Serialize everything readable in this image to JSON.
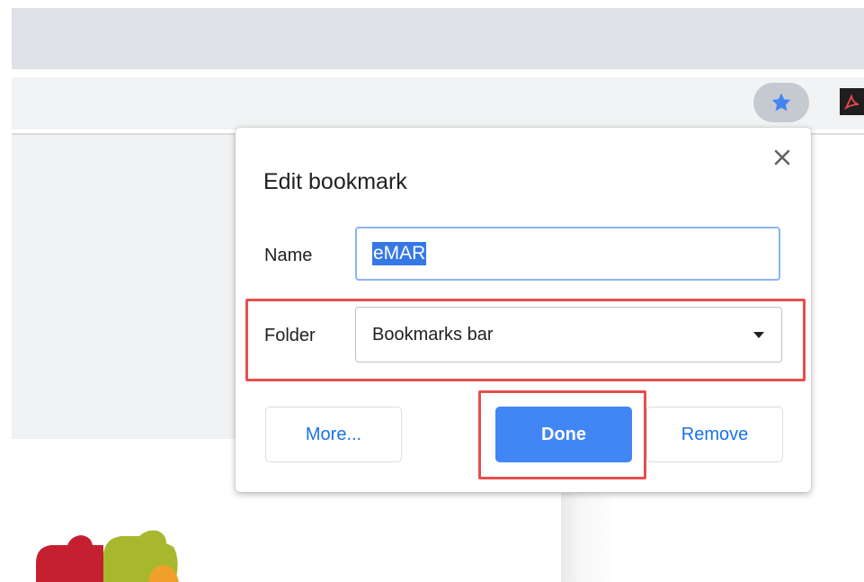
{
  "browser": {
    "bookmark_star": {
      "icon": "star-icon",
      "color": "#4285f4"
    },
    "extension": {
      "icon": "adobe-acrobat-icon",
      "color": "#c8102e"
    }
  },
  "dialog": {
    "title": "Edit bookmark",
    "close_icon": "close-icon",
    "name_label": "Name",
    "name_value": "eMAR",
    "folder_label": "Folder",
    "folder_value": "Bookmarks bar",
    "buttons": {
      "more": "More...",
      "done": "Done",
      "remove": "Remove"
    }
  },
  "colors": {
    "accent": "#4285f4",
    "link": "#1a73e8",
    "annotation": "#e94e4e"
  }
}
